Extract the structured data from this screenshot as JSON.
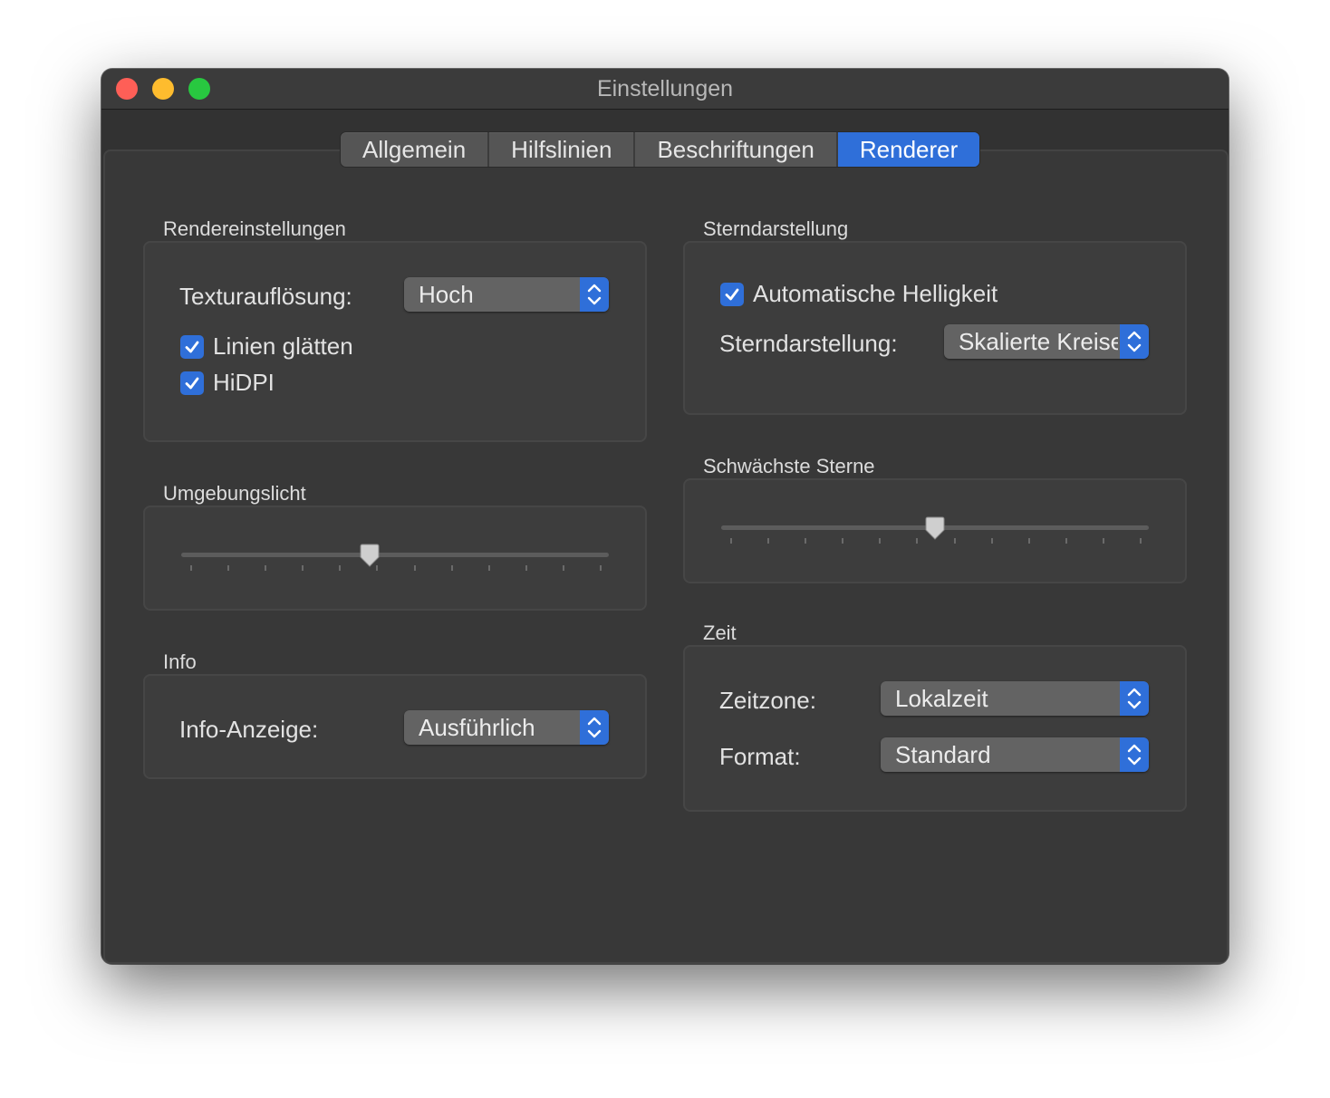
{
  "window": {
    "title": "Einstellungen"
  },
  "tabs": [
    {
      "label": "Allgemein",
      "active": false
    },
    {
      "label": "Hilfslinien",
      "active": false
    },
    {
      "label": "Beschriftungen",
      "active": false
    },
    {
      "label": "Renderer",
      "active": true
    }
  ],
  "render_settings": {
    "title": "Rendereinstellungen",
    "texture_label": "Texturauflösung:",
    "texture_value": "Hoch",
    "smooth_lines": {
      "label": "Linien glätten",
      "checked": true
    },
    "hidpi": {
      "label": "HiDPI",
      "checked": true
    }
  },
  "ambient_light": {
    "title": "Umgebungslicht",
    "value_fraction": 0.44,
    "ticks": 12
  },
  "info": {
    "title": "Info",
    "label": "Info-Anzeige:",
    "value": "Ausführlich"
  },
  "star_display": {
    "title": "Sterndarstellung",
    "auto_brightness": {
      "label": "Automatische Helligkeit",
      "checked": true
    },
    "style_label": "Sterndarstellung:",
    "style_value": "Skalierte Kreise"
  },
  "faintest_stars": {
    "title": "Schwächste Sterne",
    "value_fraction": 0.5,
    "ticks": 12
  },
  "time": {
    "title": "Zeit",
    "timezone_label": "Zeitzone:",
    "timezone_value": "Lokalzeit",
    "format_label": "Format:",
    "format_value": "Standard"
  },
  "colors": {
    "accent": "#2f6fd9",
    "window_bg": "#323232",
    "box_bg": "#3d3d3d"
  }
}
